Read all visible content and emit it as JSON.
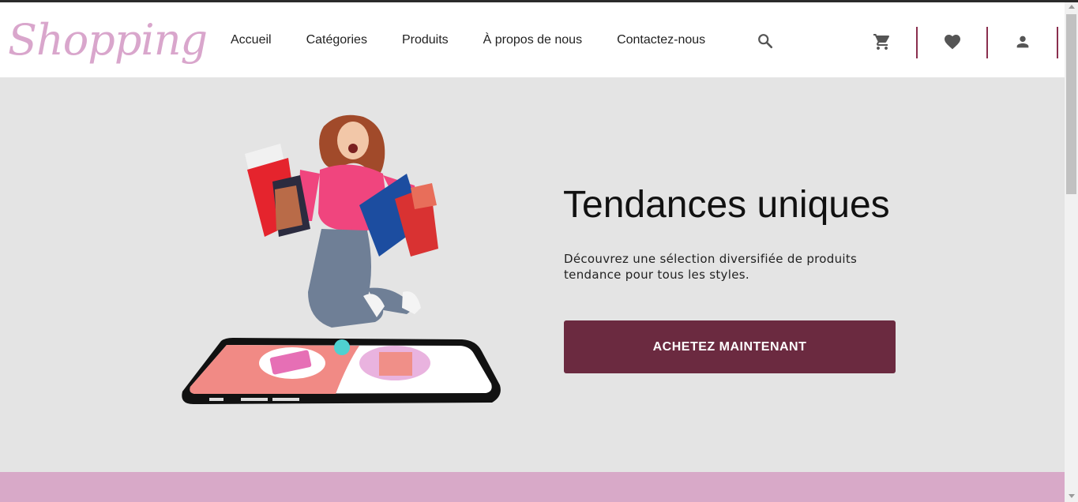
{
  "brand": {
    "logo_text": "Shopping",
    "accent_color": "#d9a6cc",
    "primary_color": "#6b2a40"
  },
  "nav": {
    "items": [
      {
        "label": "Accueil"
      },
      {
        "label": "Catégories"
      },
      {
        "label": "Produits"
      },
      {
        "label": "À propos de nous"
      },
      {
        "label": "Contactez-nous"
      }
    ]
  },
  "header_icons": [
    "search-icon",
    "cart-icon",
    "heart-icon",
    "user-icon"
  ],
  "hero": {
    "title": "Tendances uniques",
    "description": "Découvrez une sélection diversifiée de produits tendance pour tous les styles.",
    "cta_label": "ACHETEZ MAINTENANT"
  }
}
